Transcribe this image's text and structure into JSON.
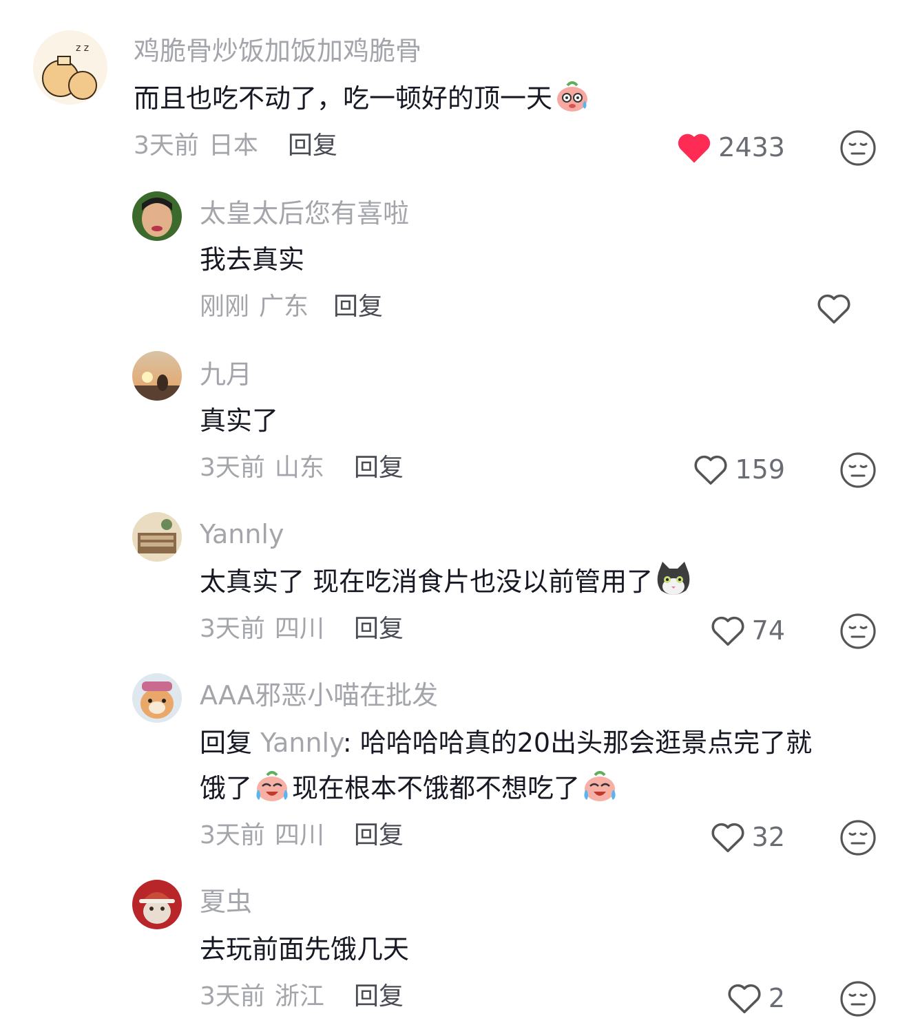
{
  "comments": [
    {
      "username": "鸡脆骨炒饭加饭加鸡脆骨",
      "text": "而且也吃不动了，吃一顿好的顶一天",
      "emoji": "sweat-face-emoji",
      "time": "3天前",
      "location": "日本",
      "reply_label": "回复",
      "likes": "2433",
      "liked": true
    },
    {
      "username": "太皇太后您有喜啦",
      "text": "我去真实",
      "time": "刚刚",
      "location": "广东",
      "reply_label": "回复",
      "likes": "",
      "liked": false
    },
    {
      "username": "九月",
      "text": "真实了",
      "time": "3天前",
      "location": "山东",
      "reply_label": "回复",
      "likes": "159",
      "liked": false
    },
    {
      "username": "Yannly",
      "text": "太真实了 现在吃消食片也没以前管用了",
      "emoji": "cat-face-emoji",
      "time": "3天前",
      "location": "四川",
      "reply_label": "回复",
      "likes": "74",
      "liked": false
    },
    {
      "username": "AAA邪恶小喵在批发",
      "reply_prefix": "回复",
      "reply_to": "Yannly",
      "text_line1": ": 哈哈哈哈真的20出头那会逛景点完了就",
      "text_line2a": "饿了",
      "text_line2b": "现在根本不饿都不想吃了",
      "emoji": "crying-laughing-emoji",
      "time": "3天前",
      "location": "四川",
      "reply_label": "回复",
      "likes": "32",
      "liked": false
    },
    {
      "username": "夏虫",
      "text": "去玩前面先饿几天",
      "time": "3天前",
      "location": "浙江",
      "reply_label": "回复",
      "likes": "2",
      "liked": false
    }
  ],
  "colors": {
    "like_active": "#fe2c55",
    "secondary_text": "#a3a5ab",
    "primary_text": "#161823"
  }
}
